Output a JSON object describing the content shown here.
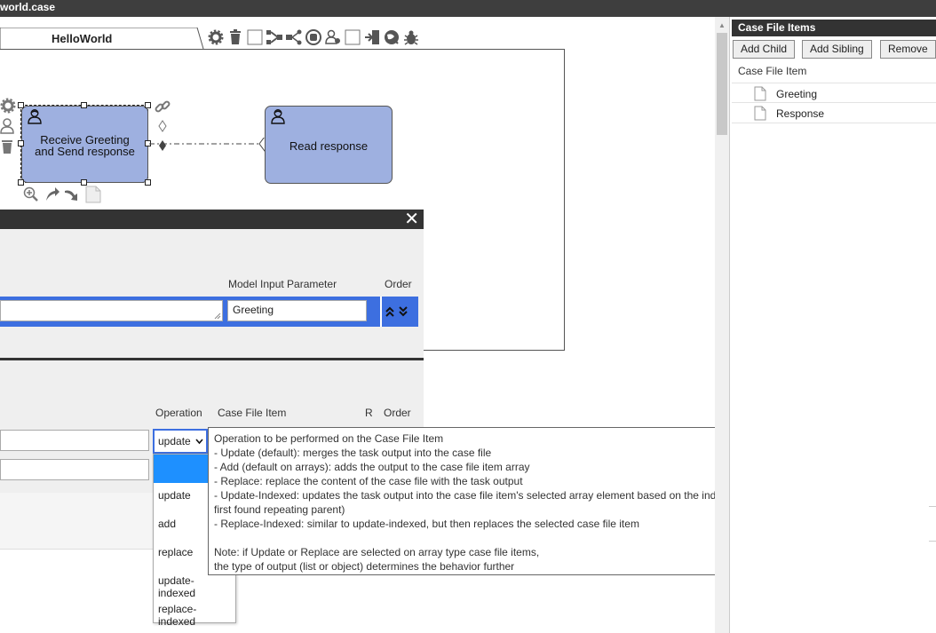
{
  "window": {
    "title": "world.case"
  },
  "editor_tab": {
    "label": "HelloWorld"
  },
  "toolbar": {
    "icons": [
      "gear-icon",
      "trash-icon",
      "blank-icon",
      "flow-icon",
      "share-icon",
      "stop-icon",
      "roles-icon",
      "blank-icon",
      "import-icon",
      "globe-icon",
      "bug-icon"
    ]
  },
  "canvas": {
    "task1": {
      "label_line1": "Receive Greeting",
      "label_line2": "and Send response"
    },
    "task2": {
      "label": "Read response"
    }
  },
  "dialog": {
    "inputs": {
      "col_model_input_parameter": "Model Input Parameter",
      "col_order": "Order",
      "row1": {
        "model_input_parameter": "Greeting"
      }
    },
    "outputs": {
      "col_operation": "Operation",
      "col_case_file_item": "Case File Item",
      "col_r": "R",
      "col_order": "Order",
      "operation_selected": "update"
    }
  },
  "operation_dropdown": {
    "options": [
      "",
      "update",
      "add",
      "replace",
      "update-indexed",
      "replace-indexed"
    ]
  },
  "tooltip": {
    "lines": [
      "Operation to be performed on the Case File Item",
      "- Update (default): merges the task output into the case file",
      "- Add (default on arrays): adds the output to the case file item array",
      "- Replace: replace the content of the case file with the task output",
      "- Update-Indexed: updates the task output into the case file item's selected array element based on the index of the current repeating plan item (or it's",
      "first found repeating parent)",
      "- Replace-Indexed: similar to update-indexed, but then replaces the selected case file item",
      "",
      "Note: if Update or Replace are selected on array type case file items,",
      "the type of output (list or object) determines the behavior further"
    ]
  },
  "case_file_items_panel": {
    "title": "Case File Items",
    "buttons": {
      "add_child": "Add Child",
      "add_sibling": "Add Sibling",
      "remove": "Remove"
    },
    "column_label": "Case File Item",
    "items": [
      "Greeting",
      "Response"
    ]
  },
  "colors": {
    "task_fill": "#9eb0e0",
    "selection_blue": "#3d6fe0",
    "highlight": "#1e90ff",
    "header_dark": "#333333"
  }
}
